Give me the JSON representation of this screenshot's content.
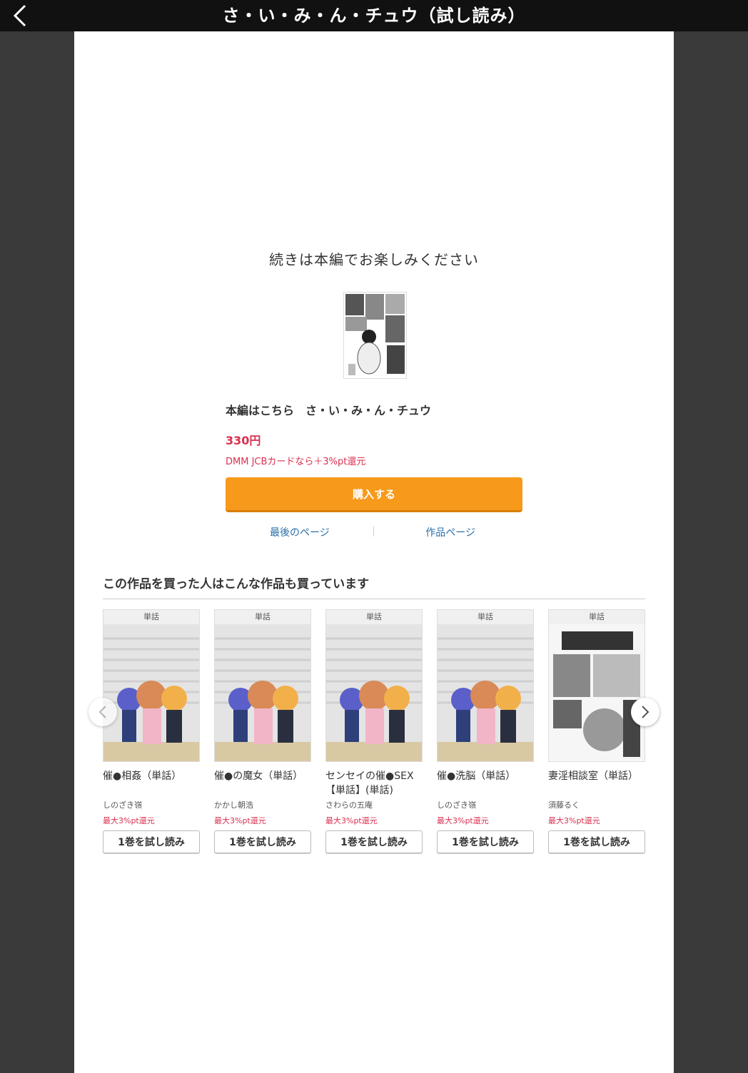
{
  "header": {
    "title": "さ・い・み・ん・チュウ（試し読み）"
  },
  "main": {
    "continue_message": "続きは本編でお楽しみください",
    "product_line": "本編はこちら　さ・い・み・ん・チュウ",
    "price": "330円",
    "jcb_note": "DMM JCBカードなら＋3%pt還元",
    "buy_label": "購入する",
    "link_last_page": "最後のページ",
    "link_work_page": "作品ページ"
  },
  "recommend": {
    "heading": "この作品を買った人はこんな作品も買っています",
    "items": [
      {
        "badge": "単話",
        "title": "催●相姦（単話）",
        "author": "しのざき嶺",
        "point": "最大3%pt還元",
        "button": "1巻を試し読み"
      },
      {
        "badge": "単話",
        "title": "催●の魔女（単話）",
        "author": "かかし朝浩",
        "point": "最大3%pt還元",
        "button": "1巻を試し読み"
      },
      {
        "badge": "単話",
        "title": "センセイの催●SEX【単話】(単話)",
        "author": "さわらの五庵",
        "point": "最大3%pt還元",
        "button": "1巻を試し読み"
      },
      {
        "badge": "単話",
        "title": "催●洗脳（単話）",
        "author": "しのざき嶺",
        "point": "最大3%pt還元",
        "button": "1巻を試し読み"
      },
      {
        "badge": "単話",
        "title": "妻淫相談室（単話）",
        "author": "須藤るく",
        "point": "最大3%pt還元",
        "button": "1巻を試し読み"
      }
    ]
  },
  "colors": {
    "accent_orange": "#f79a1c",
    "price_red": "#d9304f",
    "link_blue": "#2a6fa8"
  },
  "icons": {
    "back": "chevron-left-icon",
    "prev": "chevron-left-icon",
    "next": "chevron-right-icon"
  }
}
